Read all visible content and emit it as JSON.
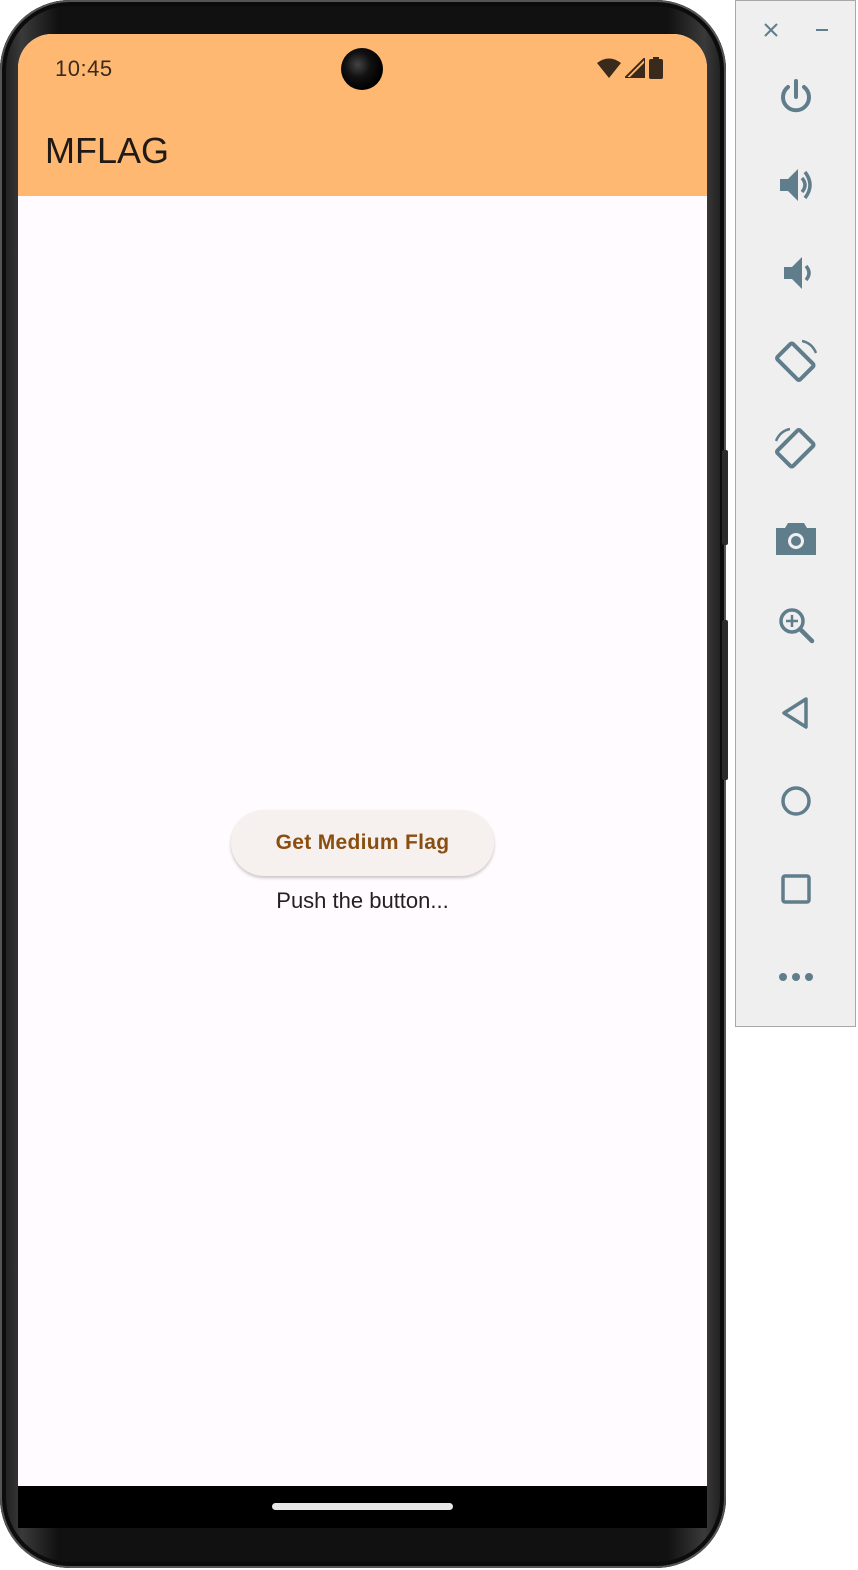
{
  "status_bar": {
    "time": "10:45",
    "background": "#ffb871"
  },
  "app_bar": {
    "title": "MFLAG",
    "background": "#ffb871"
  },
  "main": {
    "button_label": "Get Medium Flag",
    "status_text": "Push the button..."
  },
  "emulator_panel": {
    "icon_color": "#607d8b",
    "controls": [
      "close-icon",
      "minimize-icon",
      "power-icon",
      "volume-up-icon",
      "volume-down-icon",
      "rotate-left-icon",
      "rotate-right-icon",
      "camera-icon",
      "zoom-icon",
      "back-icon",
      "home-icon",
      "overview-icon",
      "more-icon"
    ]
  }
}
